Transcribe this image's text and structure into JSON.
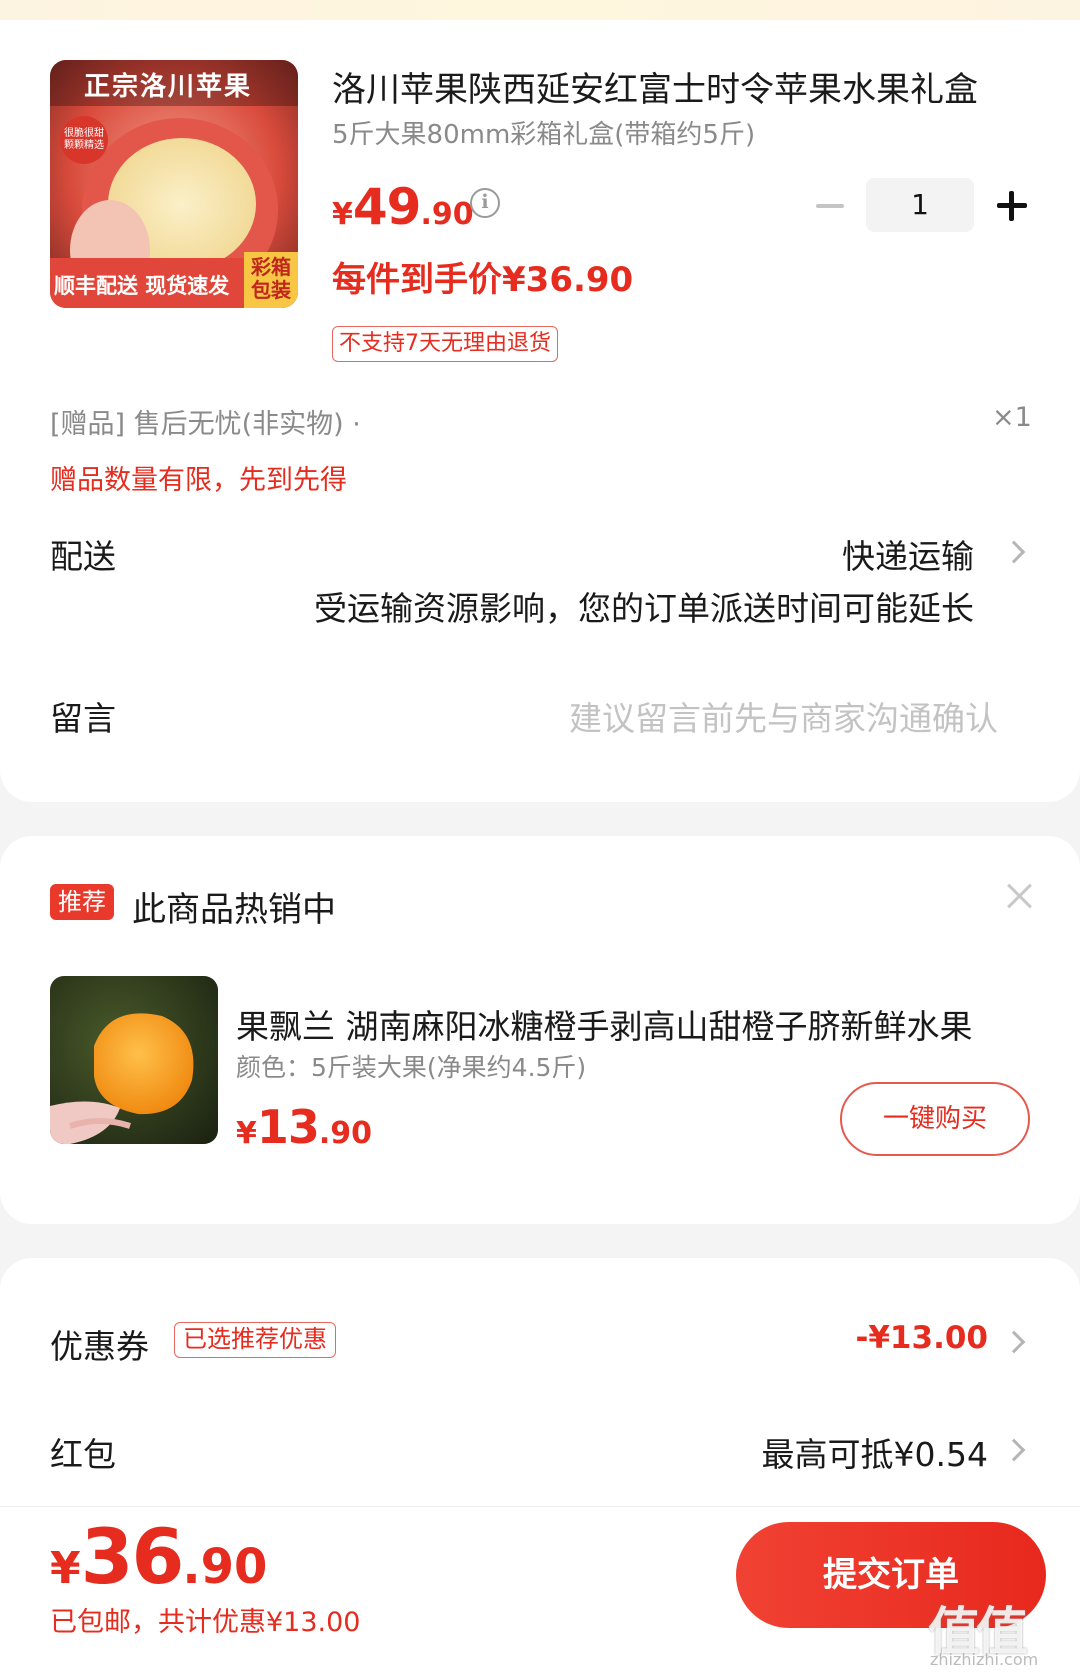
{
  "product": {
    "title": "洛川苹果陕西延安红富士时令苹果水果礼盒",
    "spec": "5斤大果80mm彩箱礼盒(带箱约5斤)",
    "price_symbol": "¥",
    "price_int": "49",
    "price_dec": ".90",
    "quantity": "1",
    "final_price": "每件到手价¥36.90",
    "no_return_tag": "不支持7天无理由退货",
    "image_banner": "正宗洛川苹果",
    "image_badge": "很脆很甜 颗颗精选",
    "image_footer": "顺丰配送 现货速发",
    "image_corner": "彩箱包装"
  },
  "gift": {
    "line": "[赠品]  售后无忧(非实物) ·",
    "qty": "×1",
    "note": "赠品数量有限，先到先得"
  },
  "delivery": {
    "label": "配送",
    "value": "快递运输",
    "note": "受运输资源影响，您的订单派送时间可能延长"
  },
  "message": {
    "label": "留言",
    "placeholder": "建议留言前先与商家沟通确认"
  },
  "recommend": {
    "badge": "推荐",
    "title": "此商品热销中",
    "name": "果飘兰 湖南麻阳冰糖橙手剥高山甜橙子脐新鲜水果",
    "spec": "颜色：5斤装大果(净果约4.5斤)",
    "price_symbol": "¥",
    "price_int": "13",
    "price_dec": ".90",
    "buy_label": "一键购买"
  },
  "coupon": {
    "label": "优惠券",
    "tag": "已选推荐优惠",
    "value": "-¥13.00"
  },
  "redpack": {
    "label": "红包",
    "value": "最高可抵¥0.54"
  },
  "bottom": {
    "total_symbol": "¥",
    "total_int": "36",
    "total_dec": ".90",
    "note": "已包邮，共计优惠¥13.00",
    "submit_label": "提交订单",
    "watermark": "值值值",
    "watermark_url": "zhizhizhi.com"
  },
  "colors": {
    "accent": "#e52c1f",
    "muted": "#8a8a8a",
    "background": "#f4f4f4"
  }
}
